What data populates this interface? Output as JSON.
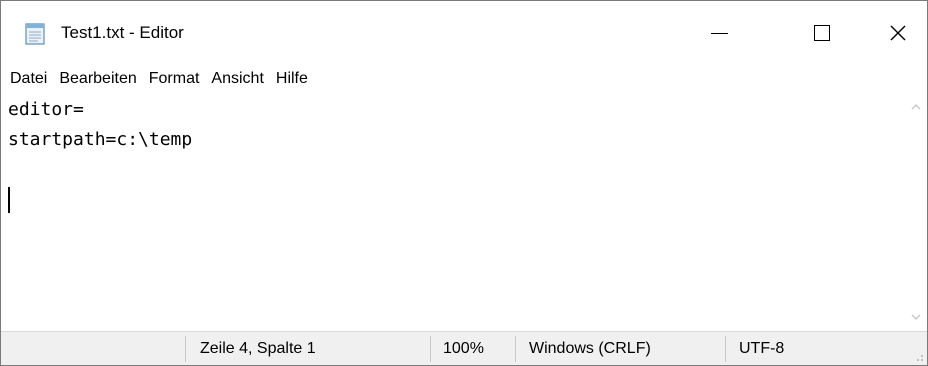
{
  "window": {
    "title": "Test1.txt - Editor",
    "icon": "notepad-icon",
    "controls": {
      "minimize_icon": "minimize-icon",
      "maximize_icon": "maximize-icon",
      "close_icon": "close-icon"
    }
  },
  "menu": {
    "items": [
      {
        "label": "Datei"
      },
      {
        "label": "Bearbeiten"
      },
      {
        "label": "Format"
      },
      {
        "label": "Ansicht"
      },
      {
        "label": "Hilfe"
      }
    ]
  },
  "editor": {
    "lines": [
      "editor=",
      "startpath=c:\\temp",
      "",
      ""
    ],
    "caret_line": 4,
    "caret_column": 1
  },
  "statusbar": {
    "position": "Zeile 4, Spalte 1",
    "zoom": "100%",
    "line_ending": "Windows (CRLF)",
    "encoding": "UTF-8"
  },
  "colors": {
    "statusbar_bg": "#f0f0f0",
    "window_bg": "#ffffff",
    "scroll_arrow": "#c4c4c4"
  }
}
